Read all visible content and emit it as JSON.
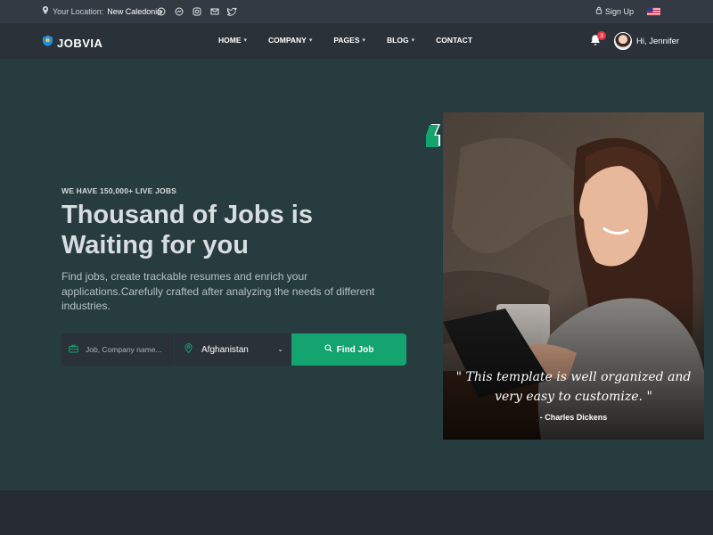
{
  "topbar": {
    "location_label": "Your Location:",
    "location_value": "New Caledonia",
    "socials": [
      "whatsapp-icon",
      "messenger-icon",
      "instagram-icon",
      "mail-icon",
      "twitter-icon"
    ],
    "signup_label": "Sign Up"
  },
  "nav": {
    "brand": "JOBVIA",
    "items": [
      {
        "label": "HOME",
        "has_dropdown": true
      },
      {
        "label": "COMPANY",
        "has_dropdown": true
      },
      {
        "label": "PAGES",
        "has_dropdown": true
      },
      {
        "label": "BLOG",
        "has_dropdown": true
      },
      {
        "label": "CONTACT",
        "has_dropdown": false
      }
    ],
    "notification_count": "3",
    "greeting": "Hi, Jennifer"
  },
  "hero": {
    "eyebrow": "WE HAVE 150,000+ LIVE JOBS",
    "title": "Thousand of Jobs is Waiting for you",
    "description": "Find jobs, create trackable resumes and enrich your applications.Carefully crafted after analyzing the needs of different industries."
  },
  "search": {
    "job_placeholder": "Job, Company name...",
    "location_value": "Afghanistan",
    "button_label": "Find Job"
  },
  "testimonial": {
    "quote_line1": "\" This template is well organized and",
    "quote_line2": "very easy to customize. \"",
    "author": "- Charles Dickens"
  },
  "colors": {
    "accent": "#14a46f",
    "hero_bg": "#263c3e",
    "nav_bg": "#2b3139",
    "topbar_bg": "#333a43",
    "badge": "#e63946"
  }
}
